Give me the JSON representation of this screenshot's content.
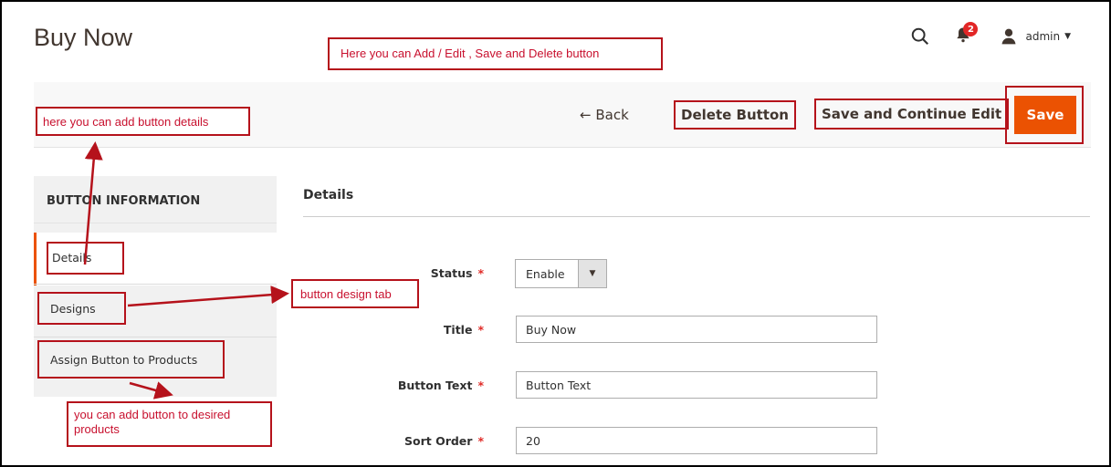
{
  "header": {
    "title": "Buy Now",
    "notification_count": "2",
    "user": "admin"
  },
  "toolbar": {
    "back_label": "← Back",
    "delete_label": "Delete Button",
    "save_continue_label": "Save and Continue Edit",
    "save_label": "Save"
  },
  "sidebar": {
    "title": "BUTTON INFORMATION",
    "items": [
      {
        "label": "Details"
      },
      {
        "label": "Designs"
      },
      {
        "label": "Assign Button to Products"
      }
    ]
  },
  "main": {
    "section_title": "Details",
    "fields": {
      "status_label": "Status",
      "status_value": "Enable",
      "title_label": "Title",
      "title_value": "Buy Now",
      "button_text_label": "Button Text",
      "button_text_value": "Button Text",
      "sort_order_label": "Sort Order",
      "sort_order_value": "20"
    },
    "required_mark": "*"
  },
  "annotations": {
    "top": "Here you can Add / Edit , Save and Delete button",
    "details": "here you can add button details",
    "design_tab": "button design tab",
    "products": "you can add button to desired products"
  },
  "colors": {
    "accent": "#eb5202",
    "annotation_red": "#b5121b",
    "required": "#e02b27"
  }
}
